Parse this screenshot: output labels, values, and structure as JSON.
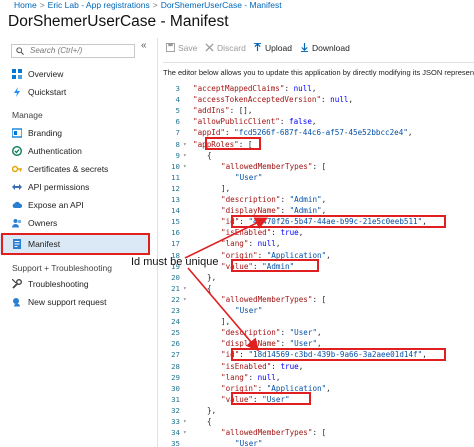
{
  "breadcrumb": [
    "Home",
    "Eric Lab - App registrations",
    "DorShemerUserCase - Manifest"
  ],
  "title": "DorShemerUserCase - Manifest",
  "sidebar": {
    "search_placeholder": "Search (Ctrl+/)",
    "collapse_glyph": "«",
    "top_items": [
      {
        "label": "Overview",
        "icon": "overview-icon"
      },
      {
        "label": "Quickstart",
        "icon": "quickstart-icon"
      }
    ],
    "manage_header": "Manage",
    "manage_items": [
      {
        "label": "Branding",
        "icon": "branding-icon"
      },
      {
        "label": "Authentication",
        "icon": "authentication-icon"
      },
      {
        "label": "Certificates & secrets",
        "icon": "key-icon"
      },
      {
        "label": "API permissions",
        "icon": "api-permissions-icon"
      },
      {
        "label": "Expose an API",
        "icon": "cloud-icon"
      },
      {
        "label": "Owners",
        "icon": "owners-icon"
      },
      {
        "label": "Manifest",
        "icon": "manifest-icon",
        "selected": true
      }
    ],
    "support_header": "Support + Troubleshooting",
    "support_items": [
      {
        "label": "Troubleshooting",
        "icon": "wrench-icon"
      },
      {
        "label": "New support request",
        "icon": "support-request-icon"
      }
    ]
  },
  "toolbar": {
    "save": "Save",
    "discard": "Discard",
    "upload": "Upload",
    "download": "Download"
  },
  "description": "The editor below allows you to update this application by directly modifying its JSON represen",
  "editor": {
    "lines": [
      {
        "n": "3",
        "text": "\"acceptMappedClaims\": null,",
        "indent": 1
      },
      {
        "n": "4",
        "text": "\"accessTokenAcceptedVersion\": null,",
        "indent": 1
      },
      {
        "n": "5",
        "text": "\"addIns\": [],",
        "indent": 1
      },
      {
        "n": "6",
        "text": "\"allowPublicClient\": false,",
        "indent": 1
      },
      {
        "n": "7",
        "text": "\"appId\": \"fcd5266f-687f-44c6-af57-45e52bbcc2e4\",",
        "indent": 1
      },
      {
        "n": "8",
        "text": "\"appRoles\": [",
        "indent": 1
      },
      {
        "n": "9",
        "text": "{",
        "indent": 2
      },
      {
        "n": "10",
        "text": "\"allowedMemberTypes\": [",
        "indent": 3
      },
      {
        "n": "11",
        "text": "\"User\"",
        "indent": 4
      },
      {
        "n": "12",
        "text": "],",
        "indent": 3
      },
      {
        "n": "13",
        "text": "\"description\": \"Admin\",",
        "indent": 3
      },
      {
        "n": "14",
        "text": "\"displayName\": \"Admin\",",
        "indent": 3
      },
      {
        "n": "15",
        "text": "\"id\": \"4b470f26-5b47-44ae-b99c-21e5c0eeb511\",",
        "indent": 3
      },
      {
        "n": "16",
        "text": "\"isEnabled\": true,",
        "indent": 3
      },
      {
        "n": "17",
        "text": "\"lang\": null,",
        "indent": 3
      },
      {
        "n": "18",
        "text": "\"origin\": \"Application\",",
        "indent": 3
      },
      {
        "n": "19",
        "text": "\"value\": \"Admin\"",
        "indent": 3
      },
      {
        "n": "20",
        "text": "},",
        "indent": 2
      },
      {
        "n": "21",
        "text": "{",
        "indent": 2
      },
      {
        "n": "22",
        "text": "\"allowedMemberTypes\": [",
        "indent": 3
      },
      {
        "n": "23",
        "text": "\"User\"",
        "indent": 4
      },
      {
        "n": "24",
        "text": "],",
        "indent": 3
      },
      {
        "n": "25",
        "text": "\"description\": \"User\",",
        "indent": 3
      },
      {
        "n": "26",
        "text": "\"displayName\": \"User\",",
        "indent": 3
      },
      {
        "n": "27",
        "text": "\"id\": \"18d14569-c3bd-439b-9a66-3a2aee01d14f\",",
        "indent": 3
      },
      {
        "n": "28",
        "text": "\"isEnabled\": true,",
        "indent": 3
      },
      {
        "n": "29",
        "text": "\"lang\": null,",
        "indent": 3
      },
      {
        "n": "30",
        "text": "\"origin\": \"Application\",",
        "indent": 3
      },
      {
        "n": "31",
        "text": "\"value\": \"User\"",
        "indent": 3
      },
      {
        "n": "32",
        "text": "},",
        "indent": 2
      },
      {
        "n": "33",
        "text": "{",
        "indent": 2
      },
      {
        "n": "34",
        "text": "\"allowedMemberTypes\": [",
        "indent": 3
      },
      {
        "n": "35",
        "text": "\"User\"",
        "indent": 4
      }
    ]
  },
  "annotation": {
    "text": "Id must be unique",
    "color": "#e02020"
  },
  "colors": {
    "link": "#0066b8",
    "selected_bg": "#dbe8f5",
    "highlight": "#e02020"
  }
}
